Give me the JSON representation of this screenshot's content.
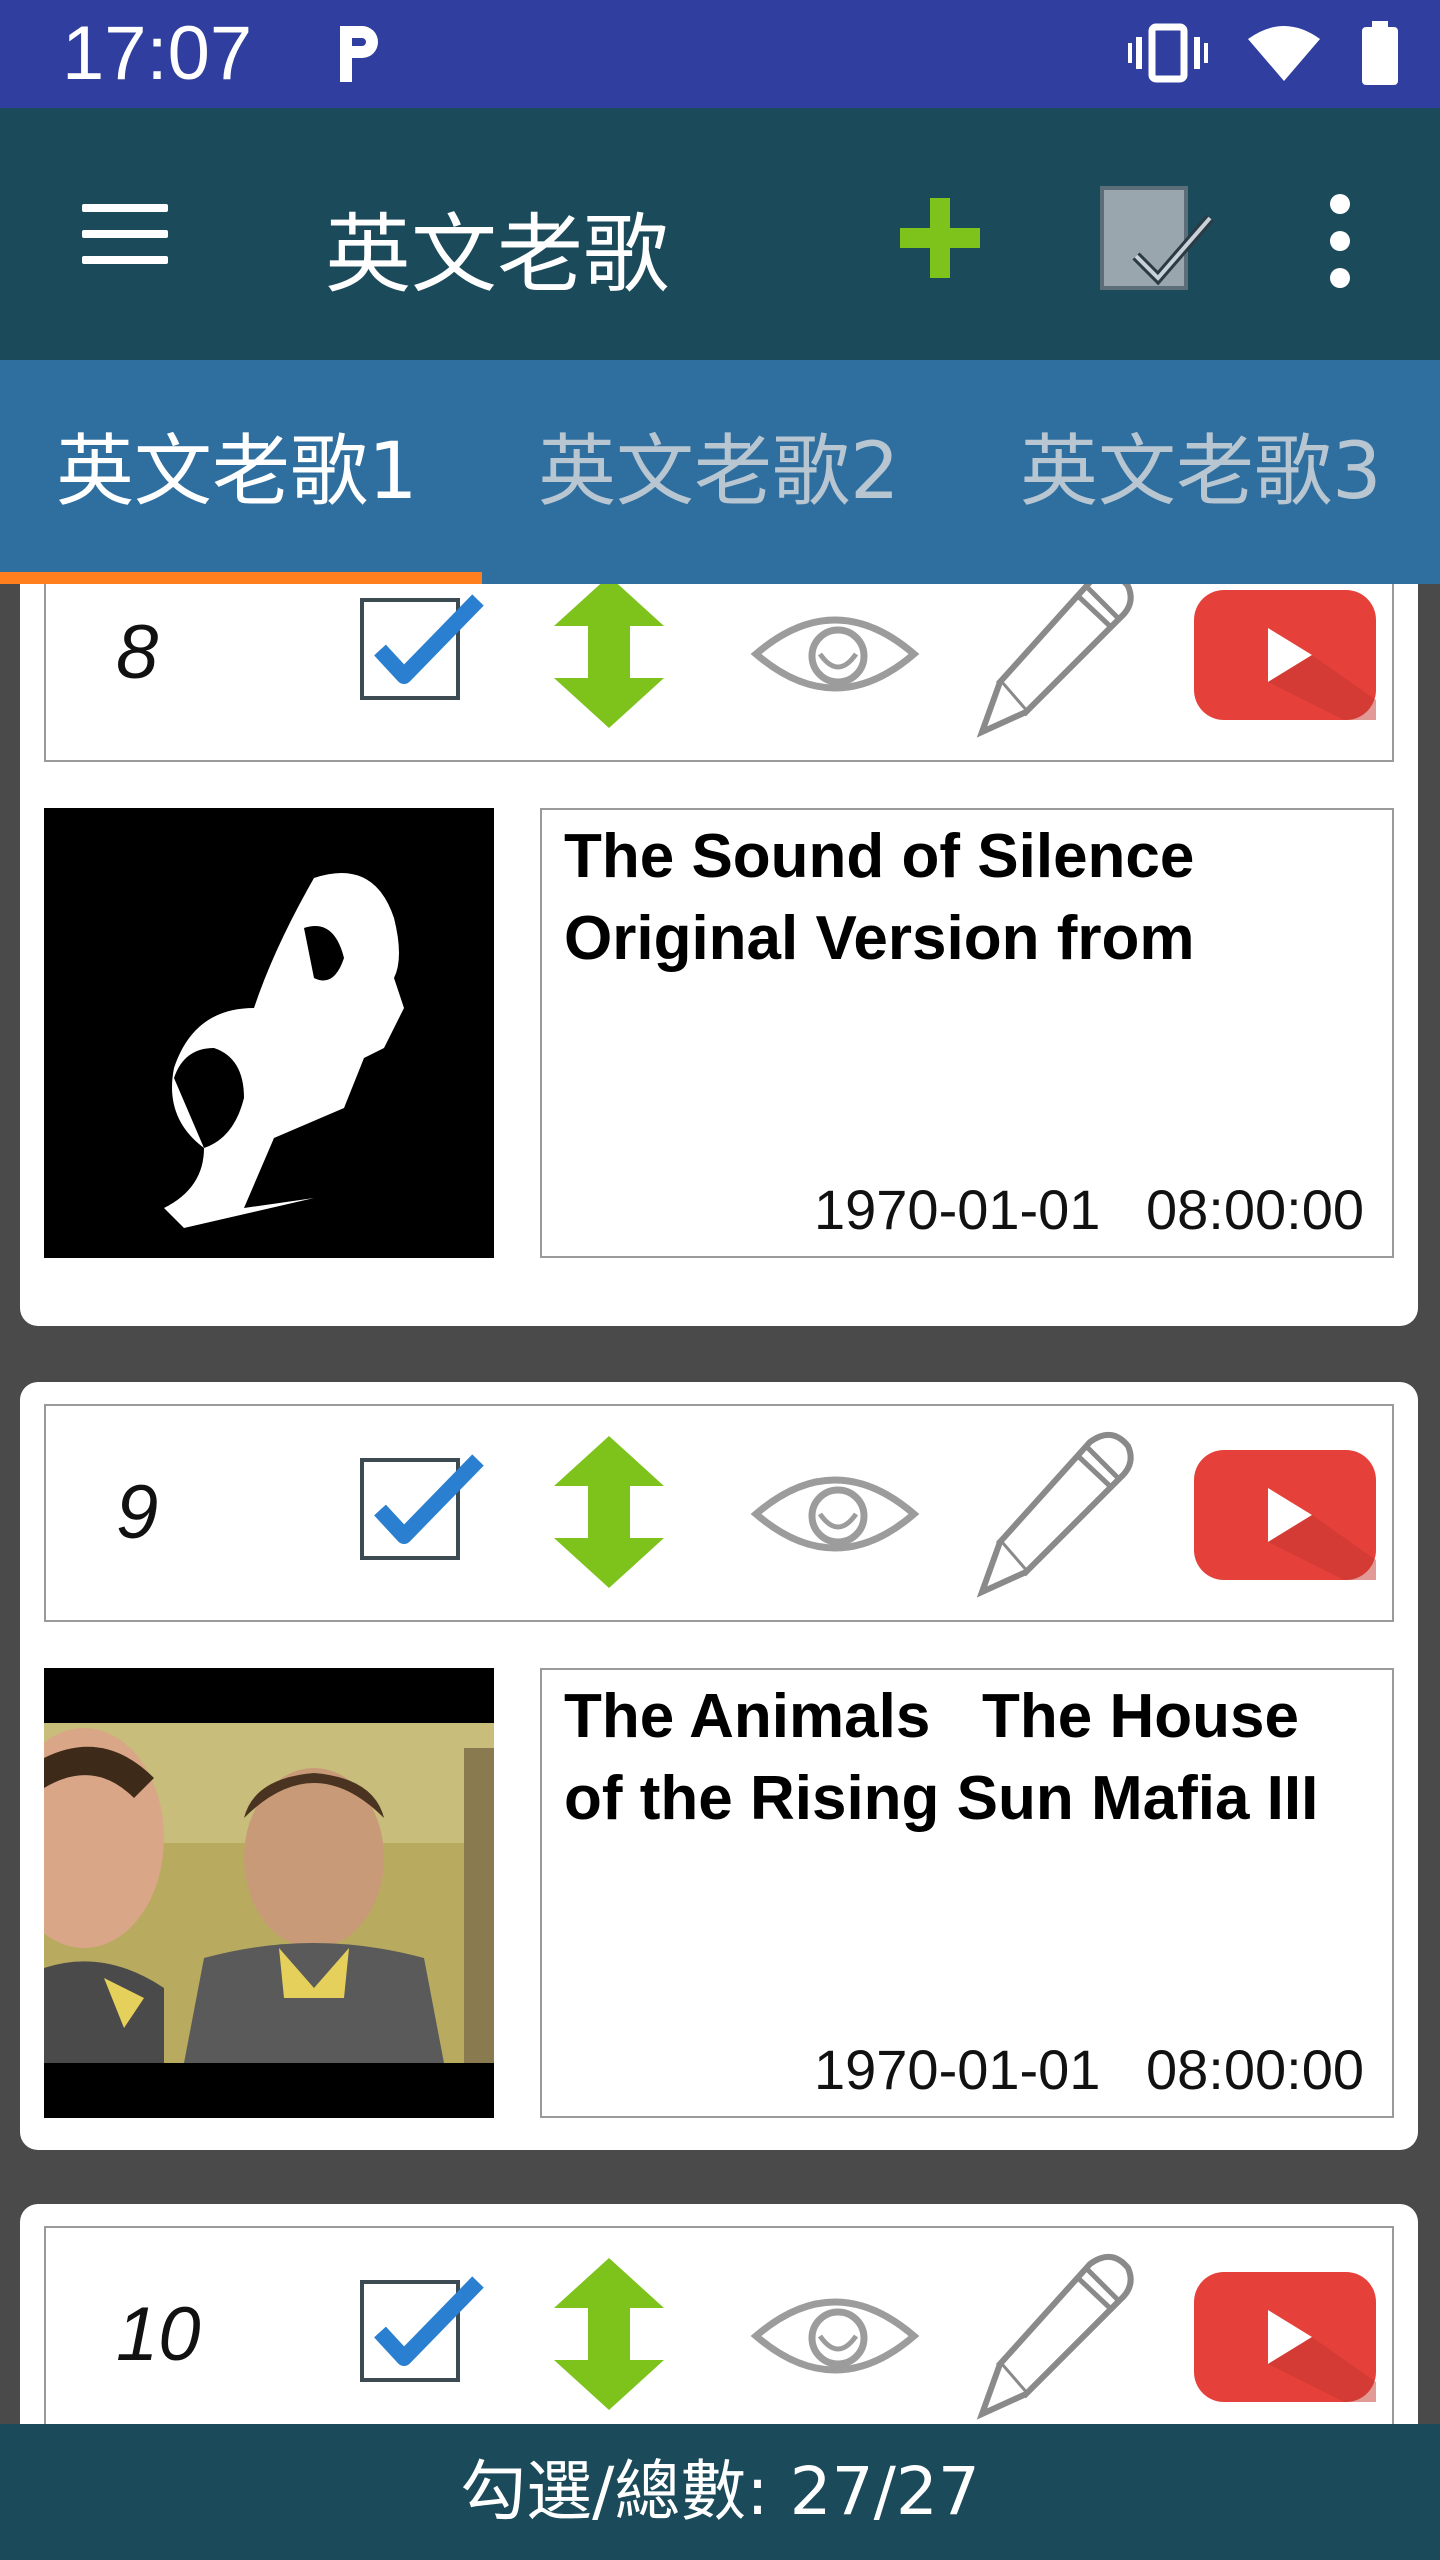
{
  "status_bar": {
    "time": "17:07",
    "notification_icon": "parking-p-icon",
    "icons": [
      "vibrate-icon",
      "wifi-icon",
      "battery-icon"
    ]
  },
  "app_bar": {
    "title": "英文老歌",
    "actions": [
      "menu-icon",
      "add-icon",
      "select-all-icon",
      "more-vert-icon"
    ]
  },
  "tabs": [
    {
      "label": "英文老歌1",
      "active": true
    },
    {
      "label": "英文老歌2",
      "active": false
    },
    {
      "label": "英文老歌3",
      "active": false
    }
  ],
  "items": [
    {
      "number": "8",
      "checked": true,
      "title": "The Sound of Silence Original Version from",
      "date": "1970-01-01 08:00:00",
      "thumbnail": "black-and-white-portrait"
    },
    {
      "number": "9",
      "checked": true,
      "title": "The Animals   The House of the Rising Sun Mafia III",
      "date": "1970-01-01 08:00:00",
      "thumbnail": "band-photo"
    },
    {
      "number": "10",
      "checked": true,
      "title": "",
      "date": "",
      "thumbnail": ""
    }
  ],
  "footer": {
    "count_text": "勾選/總數: 27/27"
  },
  "colors": {
    "status_bar": "#303f9f",
    "app_bar": "#1b4a5a",
    "tab_bar": "#2f6f9f",
    "tab_indicator": "#ff7f1e",
    "accent_green": "#7ec21c",
    "youtube_red": "#e5413a"
  }
}
